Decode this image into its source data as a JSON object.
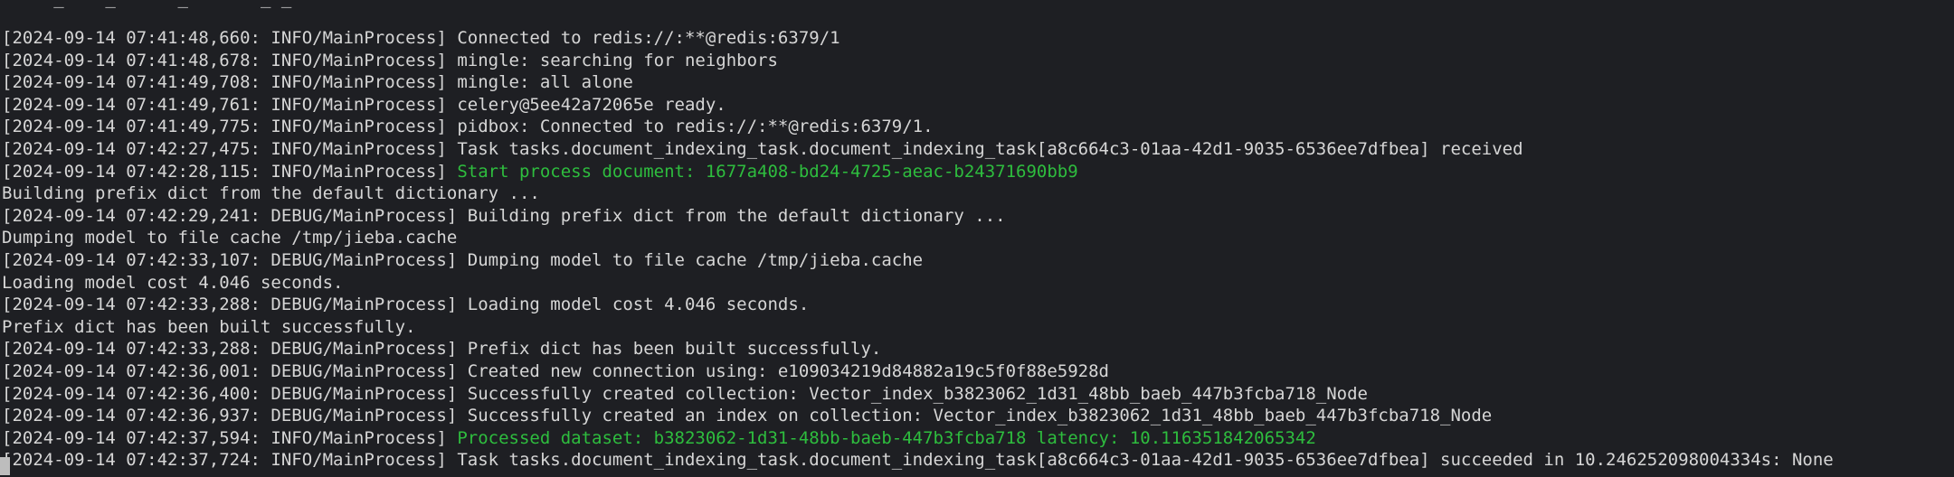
{
  "terminal": {
    "clipped_top_line": "     _    _      _       _ _       ",
    "lines": [
      {
        "prefix": "[2024-09-14 07:41:48,660: INFO/MainProcess] ",
        "message": "Connected to redis://:**@redis:6379/1",
        "highlight": false
      },
      {
        "prefix": "[2024-09-14 07:41:48,678: INFO/MainProcess] ",
        "message": "mingle: searching for neighbors",
        "highlight": false
      },
      {
        "prefix": "[2024-09-14 07:41:49,708: INFO/MainProcess] ",
        "message": "mingle: all alone",
        "highlight": false
      },
      {
        "prefix": "[2024-09-14 07:41:49,761: INFO/MainProcess] ",
        "message": "celery@5ee42a72065e ready.",
        "highlight": false
      },
      {
        "prefix": "[2024-09-14 07:41:49,775: INFO/MainProcess] ",
        "message": "pidbox: Connected to redis://:**@redis:6379/1.",
        "highlight": false
      },
      {
        "prefix": "[2024-09-14 07:42:27,475: INFO/MainProcess] ",
        "message": "Task tasks.document_indexing_task.document_indexing_task[a8c664c3-01aa-42d1-9035-6536ee7dfbea] received",
        "highlight": false
      },
      {
        "prefix": "[2024-09-14 07:42:28,115: INFO/MainProcess] ",
        "message": "Start process document: 1677a408-bd24-4725-aeac-b24371690bb9",
        "highlight": true
      },
      {
        "prefix": "",
        "message": "Building prefix dict from the default dictionary ...",
        "highlight": false
      },
      {
        "prefix": "[2024-09-14 07:42:29,241: DEBUG/MainProcess] ",
        "message": "Building prefix dict from the default dictionary ...",
        "highlight": false
      },
      {
        "prefix": "",
        "message": "Dumping model to file cache /tmp/jieba.cache",
        "highlight": false
      },
      {
        "prefix": "[2024-09-14 07:42:33,107: DEBUG/MainProcess] ",
        "message": "Dumping model to file cache /tmp/jieba.cache",
        "highlight": false
      },
      {
        "prefix": "",
        "message": "Loading model cost 4.046 seconds.",
        "highlight": false
      },
      {
        "prefix": "[2024-09-14 07:42:33,288: DEBUG/MainProcess] ",
        "message": "Loading model cost 4.046 seconds.",
        "highlight": false
      },
      {
        "prefix": "",
        "message": "Prefix dict has been built successfully.",
        "highlight": false
      },
      {
        "prefix": "[2024-09-14 07:42:33,288: DEBUG/MainProcess] ",
        "message": "Prefix dict has been built successfully.",
        "highlight": false
      },
      {
        "prefix": "[2024-09-14 07:42:36,001: DEBUG/MainProcess] ",
        "message": "Created new connection using: e109034219d84882a19c5f0f88e5928d",
        "highlight": false
      },
      {
        "prefix": "[2024-09-14 07:42:36,400: DEBUG/MainProcess] ",
        "message": "Successfully created collection: Vector_index_b3823062_1d31_48bb_baeb_447b3fcba718_Node",
        "highlight": false
      },
      {
        "prefix": "[2024-09-14 07:42:36,937: DEBUG/MainProcess] ",
        "message": "Successfully created an index on collection: Vector_index_b3823062_1d31_48bb_baeb_447b3fcba718_Node",
        "highlight": false
      },
      {
        "prefix": "[2024-09-14 07:42:37,594: INFO/MainProcess] ",
        "message": "Processed dataset: b3823062-1d31-48bb-baeb-447b3fcba718 latency: 10.116351842065342",
        "highlight": true
      },
      {
        "prefix": "[2024-09-14 07:42:37,724: INFO/MainProcess] ",
        "message": "Task tasks.document_indexing_task.document_indexing_task[a8c664c3-01aa-42d1-9035-6536ee7dfbea] succeeded in 10.246252098004334s: None",
        "highlight": false
      }
    ]
  },
  "colors": {
    "background": "#1e1f23",
    "text": "#d6d6d6",
    "highlight": "#2ebd3e",
    "cursor": "#bdbdbd"
  }
}
